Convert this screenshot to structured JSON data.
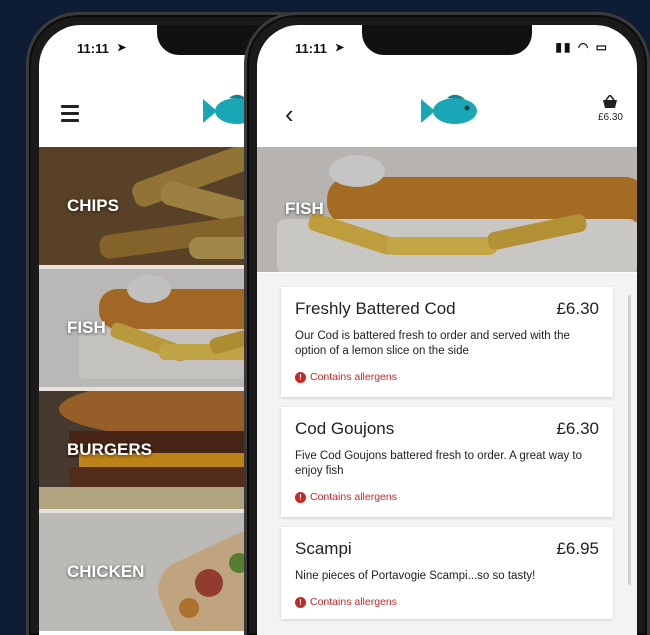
{
  "colors": {
    "background": "#0f1d34",
    "fish_logo": "#1aa7b5",
    "allergen": "#c62828"
  },
  "left_phone": {
    "status_time": "11:11",
    "menu_icon": "hamburger-icon",
    "categories": [
      {
        "label": "CHIPS"
      },
      {
        "label": "FISH"
      },
      {
        "label": "BURGERS"
      },
      {
        "label": "CHICKEN"
      }
    ]
  },
  "right_phone": {
    "status_time": "11:11",
    "back_icon": "back-chevron-icon",
    "basket": {
      "icon": "basket-icon",
      "total": "£6.30"
    },
    "category_title": "FISH",
    "items": [
      {
        "name": "Freshly Battered Cod",
        "price": "£6.30",
        "description": "Our Cod is battered fresh to order and served with the option of a lemon slice on the side",
        "allergen": "Contains allergens"
      },
      {
        "name": "Cod Goujons",
        "price": "£6.30",
        "description": "Five Cod Goujons battered fresh to order. A great way to enjoy fish",
        "allergen": "Contains allergens"
      },
      {
        "name": "Scampi",
        "price": "£6.95",
        "description": "Nine pieces of Portavogie Scampi...so so tasty!",
        "allergen": "Contains allergens"
      }
    ]
  }
}
